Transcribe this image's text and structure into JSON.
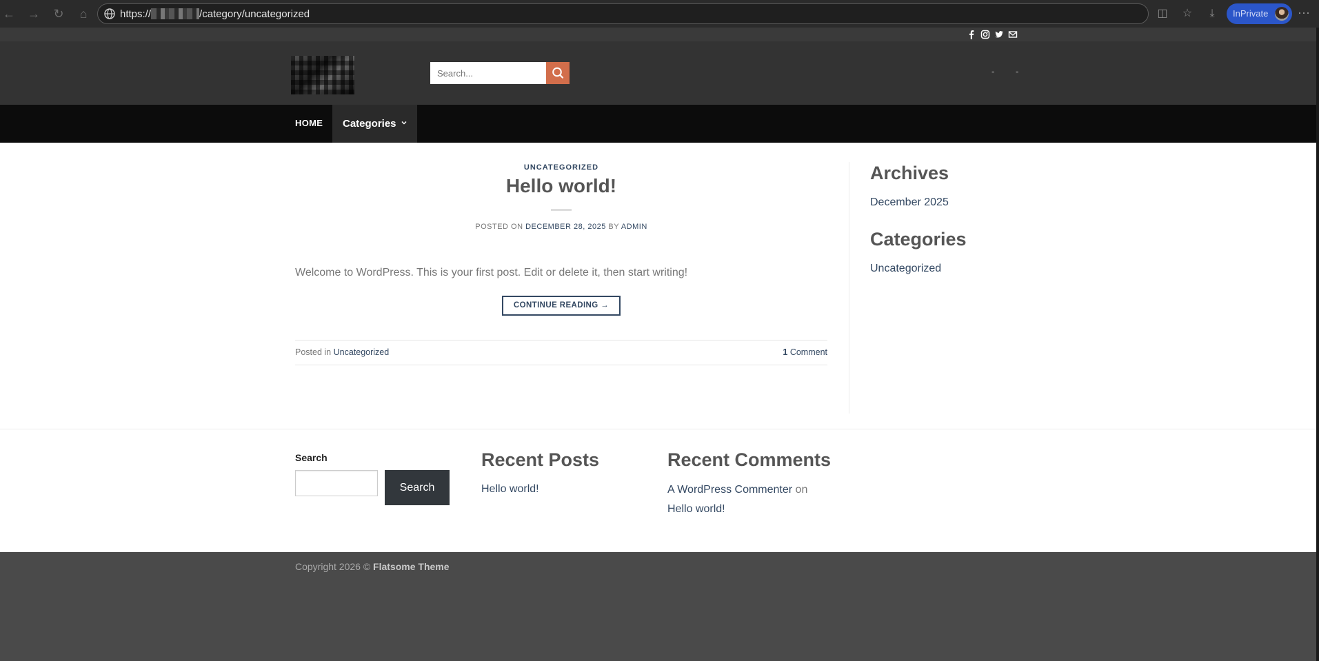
{
  "browser": {
    "url_prefix": "https://",
    "url_path": "/category/uncategorized",
    "inprivate_label": "InPrivate",
    "nav_icons": [
      "back-icon",
      "forward-icon",
      "refresh-icon",
      "home-icon"
    ],
    "more_label": "···"
  },
  "topbar": {
    "social_icons": [
      "facebook-icon",
      "instagram-icon",
      "twitter-icon",
      "mail-icon"
    ]
  },
  "header": {
    "search_placeholder": "Search...",
    "dash_1": "-",
    "dash_2": "-",
    "accent_color": "#d26e4b"
  },
  "nav": {
    "home": "HOME",
    "categories": "Categories"
  },
  "post": {
    "category": "UNCATEGORIZED",
    "title": "Hello world!",
    "meta_prefix": "POSTED ON",
    "date": "DECEMBER 28, 2025",
    "by": "BY",
    "author": "ADMIN",
    "excerpt": "Welcome to WordPress. This is your first post. Edit or delete it, then start writing!",
    "continue_label": "CONTINUE READING →",
    "posted_in_label": "Posted in",
    "posted_in_cat": "Uncategorized",
    "comment_count": "1",
    "comment_label": "Comment"
  },
  "sidebar": {
    "archives_title": "Archives",
    "archives_item": "December 2025",
    "categories_title": "Categories",
    "categories_item": "Uncategorized"
  },
  "footer_widgets": {
    "search_label": "Search",
    "search_button": "Search",
    "recent_posts_title": "Recent Posts",
    "recent_post_item": "Hello world!",
    "recent_comments_title": "Recent Comments",
    "commenter": "A WordPress Commenter",
    "on_text": "on",
    "comment_post": "Hello world!"
  },
  "footer": {
    "copyright_text": "Copyright 2026 ©",
    "theme_name": "Flatsome Theme"
  },
  "colors": {
    "link": "#334862",
    "header_bg": "#333333",
    "nav_bg": "#0c0c0c"
  }
}
